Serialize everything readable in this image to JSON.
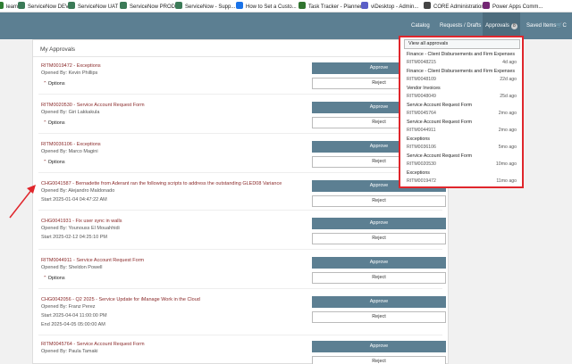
{
  "bookmarks": [
    {
      "label": "leam",
      "color": "#2e7d32",
      "icon": "bookmark-icon"
    },
    {
      "label": "ServiceNow DEV",
      "color": "#3b7a57",
      "icon": "servicenow-icon"
    },
    {
      "label": "ServiceNow UAT",
      "color": "#3b7a57",
      "icon": "servicenow-icon"
    },
    {
      "label": "ServiceNow PROD",
      "color": "#3b7a57",
      "icon": "servicenow-icon"
    },
    {
      "label": "ServiceNow - Supp...",
      "color": "#3b7a57",
      "icon": "servicenow-icon"
    },
    {
      "label": "How to Set a Custo...",
      "color": "#1a73e8",
      "icon": "page-icon"
    },
    {
      "label": "Task Tracker - Planner",
      "color": "#31752f",
      "icon": "planner-icon"
    },
    {
      "label": "viDesktop - Admin...",
      "color": "#5b5fc7",
      "icon": "citrix-icon"
    },
    {
      "label": "CORE Administration",
      "color": "#444444",
      "icon": "page-icon"
    },
    {
      "label": "Power Apps Comm...",
      "color": "#742774",
      "icon": "powerapps-icon"
    }
  ],
  "navbar": {
    "catalog": "Catalog",
    "requests": "Requests / Drafts",
    "approvals": "Approvals",
    "approvals_count": "8",
    "saved": "Saved Items",
    "cart": "C"
  },
  "approvals": {
    "title": "My Approvals",
    "approve_label": "Approve",
    "reject_label": "Reject",
    "options_label": "Options",
    "items": [
      {
        "title": "RITM0019472 - Exceptions",
        "opened_by": "Opened By: Kevin Phillips",
        "start": "",
        "end": "",
        "has_options": true
      },
      {
        "title": "RITM0020530 - Service Account Request Form",
        "opened_by": "Opened By: Giri Lakkakula",
        "start": "",
        "end": "",
        "has_options": true
      },
      {
        "title": "RITM0036106 - Exceptions",
        "opened_by": "Opened By: Marco Magini",
        "start": "",
        "end": "",
        "has_options": true
      },
      {
        "title": "CHG0041587 - Bernadette from Aderant ran the following scripts to address the outstanding GLED08 Variance",
        "opened_by": "Opened By: Alejandro Maldonado",
        "start": "Start 2025-01-04 04:47:22 AM",
        "end": "",
        "has_options": false
      },
      {
        "title": "CHG0041931 - Fix user sync in walls",
        "opened_by": "Opened By: Younouss El Mouahhidi",
        "start": "Start 2025-02-12 04:25:10 PM",
        "end": "",
        "has_options": false
      },
      {
        "title": "RITM0044911 - Service Account Request Form",
        "opened_by": "Opened By: Sheldon Powell",
        "start": "",
        "end": "",
        "has_options": true
      },
      {
        "title": "CHG0042056 - Q2 2025 - Service Update for iManage Work in the Cloud",
        "opened_by": "Opened By: Franz Perez",
        "start": "Start 2025-04-04 11:00:00 PM",
        "end": "End 2025-04-05 05:00:00 AM",
        "has_options": false
      },
      {
        "title": "RITM0045764 - Service Account Request Form",
        "opened_by": "Opened By: Paula Tamaki",
        "start": "",
        "end": "",
        "has_options": false
      }
    ]
  },
  "dropdown": {
    "view_all": "View all approvals",
    "items": [
      {
        "title": "Finance - Client Disbursements and Firm Expenses",
        "number": "RITM0048215",
        "age": "4d ago"
      },
      {
        "title": "Finance - Client Disbursements and Firm Expenses",
        "number": "RITM0048109",
        "age": "22d ago"
      },
      {
        "title": "Vendor Invoices",
        "number": "RITM0048049",
        "age": "25d ago"
      },
      {
        "title": "Service Account Request Form",
        "number": "RITM0045764",
        "age": "2mo ago"
      },
      {
        "title": "Service Account Request Form",
        "number": "RITM0044911",
        "age": "2mo ago"
      },
      {
        "title": "Exceptions",
        "number": "RITM0036106",
        "age": "5mo ago"
      },
      {
        "title": "Service Account Request Form",
        "number": "RITM0020530",
        "age": "10mo ago"
      },
      {
        "title": "Exceptions",
        "number": "RITM0019472",
        "age": "11mo ago"
      }
    ]
  },
  "annotation": {
    "arrow_color": "#e0262c",
    "highlight_color": "#e0262c"
  }
}
